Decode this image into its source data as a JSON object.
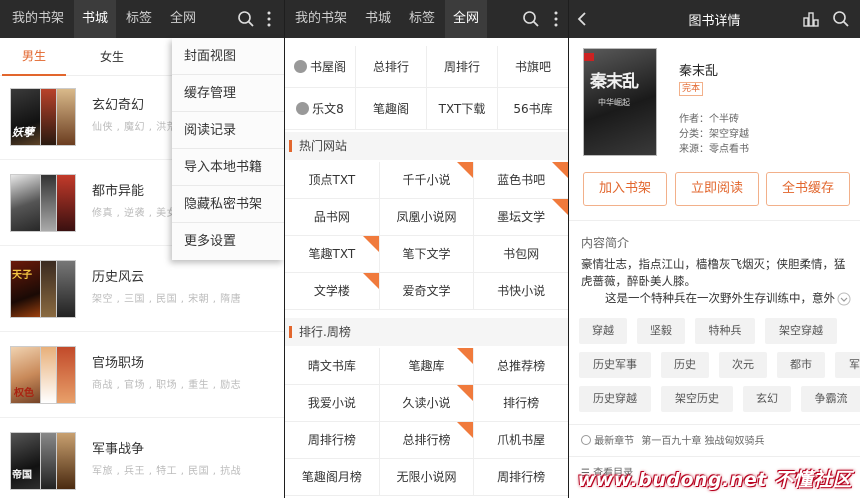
{
  "screen1": {
    "tabs": [
      "我的书架",
      "书城",
      "标签",
      "全网"
    ],
    "active_tab": 1,
    "gender_tabs": [
      "男生",
      "女生"
    ],
    "categories": [
      {
        "title": "玄幻奇幻",
        "tags": "仙侠 , 魔幻 , 洪荒"
      },
      {
        "title": "都市异能",
        "tags": "修真 , 逆袭 , 美女"
      },
      {
        "title": "历史风云",
        "tags": "架空 , 三国 , 民国 , 宋朝 , 隋唐"
      },
      {
        "title": "官场职场",
        "tags": "商战 , 官场 , 职场 , 重生 , 励志"
      },
      {
        "title": "军事战争",
        "tags": "军旅 , 兵王 , 特工 , 民国 , 抗战"
      }
    ],
    "menu": [
      "封面视图",
      "缓存管理",
      "阅读记录",
      "导入本地书籍",
      "隐藏私密书架",
      "更多设置"
    ]
  },
  "screen2": {
    "tabs": [
      "我的书架",
      "书城",
      "标签",
      "全网"
    ],
    "active_tab": 3,
    "sites_top": [
      {
        "label": "书屋阁",
        "icon": true
      },
      {
        "label": "总排行"
      },
      {
        "label": "周排行"
      },
      {
        "label": "书旗吧"
      },
      {
        "label": "乐文8",
        "icon": true
      },
      {
        "label": "笔趣阁"
      },
      {
        "label": "TXT下载"
      },
      {
        "label": "56书库"
      }
    ],
    "section_hot": "热门网站",
    "hot_sites": [
      {
        "label": "顶点TXT",
        "hot": false
      },
      {
        "label": "千千小说",
        "hot": true
      },
      {
        "label": "蓝色书吧",
        "hot": true
      },
      {
        "label": "品书网",
        "hot": false
      },
      {
        "label": "凤凰小说网",
        "hot": false
      },
      {
        "label": "墨坛文学",
        "hot": true
      },
      {
        "label": "笔趣TXT",
        "hot": true
      },
      {
        "label": "笔下文学",
        "hot": false
      },
      {
        "label": "书包网",
        "hot": false
      },
      {
        "label": "文学楼",
        "hot": true
      },
      {
        "label": "爱奇文学",
        "hot": false
      },
      {
        "label": "书快小说",
        "hot": false
      }
    ],
    "section_rank": "排行.周榜",
    "rank_sites": [
      {
        "label": "晴文书库",
        "hot": false
      },
      {
        "label": "笔趣库",
        "hot": true
      },
      {
        "label": "总推荐榜",
        "hot": false
      },
      {
        "label": "我爱小说",
        "hot": false
      },
      {
        "label": "久读小说",
        "hot": true
      },
      {
        "label": "排行榜",
        "hot": false
      },
      {
        "label": "周排行榜",
        "hot": false
      },
      {
        "label": "总排行榜",
        "hot": true
      },
      {
        "label": "爪机书屋",
        "hot": false
      },
      {
        "label": "笔趣阁月榜",
        "hot": false
      },
      {
        "label": "无限小说网",
        "hot": false
      },
      {
        "label": "周排行榜",
        "hot": false
      }
    ]
  },
  "screen3": {
    "header_title": "图书详情",
    "book": {
      "title": "秦末乱",
      "status": "完本",
      "author_label": "作者：",
      "author": "个半砖",
      "category_label": "分类：",
      "category": "架空穿越",
      "source_label": "来源：",
      "source": "零点看书",
      "cover_title": "秦末乱",
      "cover_sub": "中华崛起"
    },
    "buttons": {
      "add_shelf": "加入书架",
      "read_now": "立即阅读",
      "cache_all": "全书缓存"
    },
    "intro_heading": "内容简介",
    "intro_line1": "豪情壮志，指点江山，樯橹灰飞烟灭；侠胆柔情，猛虎蔷薇，醉卧美人膝。",
    "intro_line2": "这是一个特种兵在一次野外生存训练中，意外",
    "tags": [
      "穿越",
      "坚毅",
      "特种兵",
      "架空穿越",
      "历史军事",
      "历史",
      "次元",
      "都市",
      "军事历史",
      "历史穿越",
      "架空历史",
      "玄幻",
      "争霸流"
    ],
    "latest_label": "最新章节",
    "latest_chapter": "第一百九十章 独战匈奴骑兵",
    "catalog_label": "查看目录"
  },
  "watermark": "www.budong.net 不懂社区",
  "colors": {
    "accent": "#e2662d",
    "topbar": "#2b2b2b",
    "hot_badge": "#f07a3c"
  }
}
